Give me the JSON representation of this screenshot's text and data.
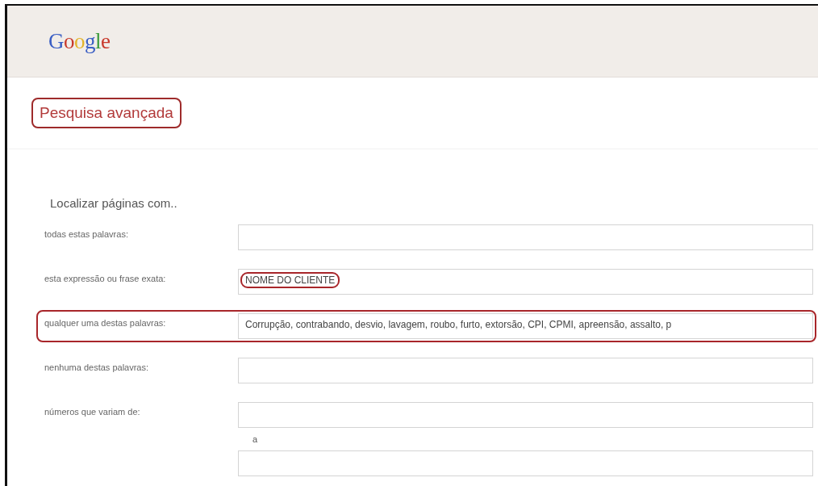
{
  "logo": {
    "text": "Google"
  },
  "title": {
    "text": "Pesquisa avançada",
    "highlighted": true
  },
  "section": {
    "heading": "Localizar páginas com.."
  },
  "fields": [
    {
      "kind": "text",
      "label": "todas estas palavras:",
      "highlighted": false
    },
    {
      "kind": "text",
      "label": "esta expressão ou frase exata:",
      "value": "NOME DO CLIENTE",
      "value_highlighted": true,
      "highlighted": false
    },
    {
      "kind": "text",
      "label": "qualquer uma destas palavras:",
      "value": "Corrupção, contrabando, desvio, lavagem, roubo, furto, extorsão, CPI, CPMI, apreensão, assalto, p",
      "value_highlighted": false,
      "highlighted": true
    },
    {
      "kind": "text",
      "label": "nenhuma destas palavras:",
      "highlighted": false
    },
    {
      "kind": "range",
      "label": "números que variam de:",
      "separator": "a",
      "highlighted": false
    }
  ]
}
